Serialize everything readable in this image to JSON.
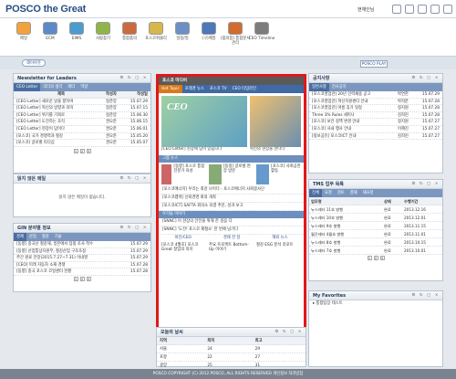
{
  "header": {
    "logo": "POSCO the Great",
    "user": "현재인님"
  },
  "apps": [
    {
      "label": "메일",
      "color": "#f2a23a"
    },
    {
      "label": "ECM",
      "color": "#5c8ac9"
    },
    {
      "label": "EIMS",
      "color": "#4b9bd0"
    },
    {
      "label": "사람찾기",
      "color": "#8fb548"
    },
    {
      "label": "통합품의",
      "color": "#cc6a3f"
    },
    {
      "label": "포스코위클리",
      "color": "#d7b64c"
    },
    {
      "label": "일정/일",
      "color": "#6d8fc5"
    },
    {
      "label": "(구)메일",
      "color": "#4c78b9"
    },
    {
      "label": "(품의함) 통합문서관리",
      "color": "#d16b2f"
    },
    {
      "label": "CEO Timeline",
      "color": "#7c7c7c"
    }
  ],
  "strip": {
    "button": "레이아웃",
    "posco_play": "POSCO PLAY"
  },
  "leaders": {
    "title": "Newsletter for Leaders",
    "tabs": [
      "CEO Letter",
      "리더의 생각",
      "레터",
      "역량"
    ],
    "cols": [
      "제목",
      "작성자",
      "작성일"
    ],
    "rows": [
      {
        "t": "[CEO Letter] 새로운 날을 향하여",
        "a": "정준양",
        "d": "15.07.29"
      },
      {
        "t": "[CEO Letter] 혁신의 방향과 의미",
        "a": "정준양",
        "d": "15.07.15"
      },
      {
        "t": "[CEO Letter] 위기를 기회로",
        "a": "정준양",
        "d": "15.06.30"
      },
      {
        "t": "[CEO Letter] 도전하는 조직",
        "a": "권오준",
        "d": "15.06.15"
      },
      {
        "t": "[CEO Letter] 현장이 답이다",
        "a": "권오준",
        "d": "15.06.01"
      },
      {
        "t": "[포스코] 국가 경쟁력과 철강",
        "a": "권오준",
        "d": "15.05.20"
      },
      {
        "t": "[포스코] 글로벌 리더십",
        "a": "권오준",
        "d": "15.05.07"
      }
    ],
    "pages": [
      "1",
      "2",
      "3"
    ]
  },
  "unread": {
    "title": "읽지 않은 메일",
    "msg": "읽지 않은 메일이 없습니다."
  },
  "gin": {
    "title": "GIN 분야별 정보",
    "tabs": [
      "경제",
      "산업",
      "철강",
      "기술"
    ],
    "items": [
      {
        "t": "[동향] 중국산 철강재, 일본에서 덤핑 조사 착수",
        "d": "15.07.29"
      },
      {
        "t": "[동향] 산업통상자원부, 철강산업 구조조정",
        "d": "15.07.29"
      },
      {
        "t": "주간 원료 전망(2015.7.27~7.31) 이내영",
        "d": "15.07.29"
      },
      {
        "t": "[CEO] 미래 자동차 소재 경쟁",
        "d": "15.07.28"
      },
      {
        "t": "[동향] 중국 포스코 코일센터 현황",
        "d": "15.07.28"
      }
    ],
    "pages": [
      "1",
      "2",
      "3"
    ]
  },
  "news": {
    "title": "포스코 미디어",
    "tabs": [
      "Hot Topic",
      "포레경 뉴스",
      "포스코 TV",
      "CEO 타임라인"
    ],
    "main_caption": "[CEO Letter] 현장에 답이 있습니다",
    "side_caption": "혁신의 현장을 만나다",
    "sub_title": "그룹 뉴스",
    "thumb_caps": [
      "[동향] 포스코 통합 전문가 육성",
      "[동정] 글로벌 현장 방문",
      "[포스코] 사회공헌 활동"
    ],
    "list": [
      "[포스코에너지] 우리는 최강 나이다 - 포스코에너지 사회봉사단",
      "[포스코켐텍] 신뢰경영 회의 개최",
      "[포스코ICT] SAFTA 회의소 의결 추진, 성과 보고"
    ],
    "sec2": "우리들 이야기",
    "list2": [
      "[SNNC] 이 현장의 안전을 위해 한 걸음 더",
      "[SNNC] '도전! 포스코 제철소' 한 번에 남기다"
    ],
    "sec3": "포스코 매거진",
    "links": [
      "비전/CEO",
      "경제 한 달",
      "해외 뉴스"
    ],
    "bottom_caps": [
      "[포스코 4월호] 포스코 Great 창업의 의지",
      "주요 프로젝트 Bottom-Up 이야기",
      "철강 ESG 분석 리포트"
    ]
  },
  "weather": {
    "title": "오늘의 날씨",
    "cols": [
      "지역",
      "최저",
      "최고"
    ],
    "rows": [
      {
        "c": "서울",
        "lo": "24",
        "hi": "29"
      },
      {
        "c": "포항",
        "lo": "22",
        "hi": "27"
      },
      {
        "c": "광양",
        "lo": "25",
        "hi": "31"
      }
    ]
  },
  "notices": {
    "title": "공지사항",
    "tabs": [
      "일반사항",
      "전사공지"
    ],
    "items": [
      {
        "t": "[포스코영업관] 20년 인력채용 공고",
        "a": "박연한",
        "d": "15.07.29"
      },
      {
        "t": "[포스코영업관] 혁신지원센터 안내",
        "a": "박희준",
        "d": "15.07.28"
      },
      {
        "t": "[포스코영업관] 여름 휴가 일정",
        "a": "정지원",
        "d": "15.07.28"
      },
      {
        "t": "Three 3% Rules 세미나",
        "a": "김희진",
        "d": "15.07.28"
      },
      {
        "t": "[포스코] 보안 정책 변경 안내",
        "a": "정지원",
        "d": "15.07.27"
      },
      {
        "t": "[포스코] 사내 행사 안내",
        "a": "이혜진",
        "d": "15.07.27"
      },
      {
        "t": "[정보공유] 포스코ICT 안내",
        "a": "김희진",
        "d": "15.07.27"
      }
    ]
  },
  "tms": {
    "title": "TMS 업무 목록",
    "tabs": [
      "전체",
      "요청",
      "검토",
      "결재",
      "재요청"
    ],
    "cols": [
      "업무명",
      "상태",
      "수행기간"
    ],
    "rows": [
      {
        "n": "뉴스레터 11호 발행",
        "s": "완료",
        "d": "2013.12.16"
      },
      {
        "n": "뉴스레터 10호 발행",
        "s": "완료",
        "d": "2013.12.01"
      },
      {
        "n": "뉴스레터 9호 발행",
        "s": "완료",
        "d": "2013.11.15"
      },
      {
        "n": "월간레터 4월호 발행",
        "s": "완료",
        "d": "2013.11.01"
      },
      {
        "n": "뉴스레터 8호 발행",
        "s": "완료",
        "d": "2013.10.15"
      },
      {
        "n": "뉴스레터 7호 발행",
        "s": "완료",
        "d": "2013.10.01"
      }
    ],
    "pages": [
      "1",
      "2",
      "3"
    ]
  },
  "favorites": {
    "title": "My Favorites",
    "item": "통합팀장 테스트"
  },
  "footer": "POSCO COPYRIGHT (C) 2012 POSCO, ALL RIGHTS RESERVED  개인정보 처리방침"
}
